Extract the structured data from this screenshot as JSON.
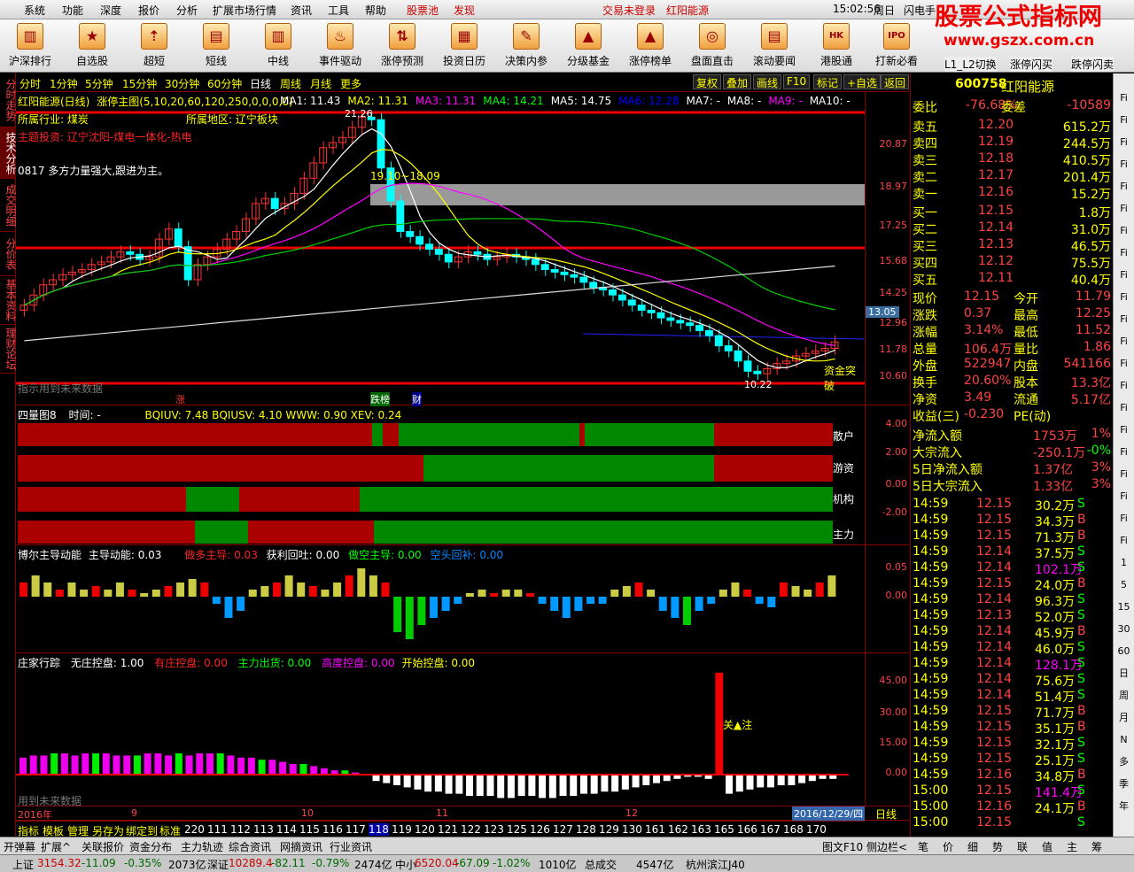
{
  "menu": [
    "系统",
    "功能",
    "深度",
    "报价",
    "分析",
    "扩展市场行情",
    "资讯",
    "工具",
    "帮助",
    "股票池",
    "发现"
  ],
  "menu_status": {
    "login": "交易未登录",
    "stock_name": "红阳能源",
    "time": "15:02:56",
    "weekday": "周日",
    "right": "闪电手"
  },
  "toolbar": [
    "沪深排行",
    "自选股",
    "超短",
    "短线",
    "中线",
    "事件驱动",
    "涨停预测",
    "投资日历",
    "决策内参",
    "分级基金",
    "涨停榜单",
    "盘面直击",
    "滚动要闻",
    "港股通",
    "打新必看"
  ],
  "toolbar_extra": [
    "L1_L2切换",
    "涨停闪买",
    "跌停闪卖"
  ],
  "brand": {
    "title": "股票公式指标网",
    "url": "www.gszx.com.cn"
  },
  "left_tabs": [
    "分时走势",
    "技术分析",
    "成交明细",
    "分价表",
    "基本资料",
    "理财论坛"
  ],
  "periods": [
    "分时",
    "1分钟",
    "5分钟",
    "15分钟",
    "30分钟",
    "60分钟",
    "日线",
    "周线",
    "月线",
    "更多"
  ],
  "period_right": [
    "复权",
    "叠加",
    "画线",
    "F10",
    "标记",
    "+自选",
    "返回"
  ],
  "main": {
    "title": "红阳能源(日线)",
    "indicator": "涨停主图(5,10,20,60,120,250,0,0,0,0)",
    "ma": [
      "MA1: 11.43",
      "MA2: 11.31",
      "MA3: 11.31",
      "MA4: 14.21",
      "MA5: 14.75",
      "MA6: 12.28",
      "MA7: -",
      "MA8: -",
      "MA9: -",
      "MA10: -"
    ],
    "industry": "所属行业: 煤炭",
    "region": "所属地区: 辽宁板块",
    "theme": "主题投资: 辽宁沈阳-煤电一体化-热电",
    "note": "0817  多方力量强大,跟进为主。",
    "hi": "21.26",
    "mid": "19.10~18.09",
    "lo": "10.22",
    "box": "资金突破",
    "future": "指示用到未来数据",
    "tags": [
      "涨",
      "跌榜",
      "财"
    ],
    "yaxis": [
      "20.87",
      "18.97",
      "17.25",
      "15.68",
      "14.25",
      "12.96",
      "11.78",
      "10.60"
    ],
    "cur": "13.05"
  },
  "sub1": {
    "title": "四量图8",
    "time": "时间: -",
    "vals": "BQIUV: 7.48  BQIUSV: 4.10  WWW: 0.90  XEV: 0.24",
    "rows": [
      "散户",
      "游资",
      "机构",
      "主力"
    ],
    "yaxis": [
      "4.00",
      "2.00",
      "0.00",
      "-2.00"
    ]
  },
  "sub2": {
    "title": "博尔主导动能",
    "v1": "主导动能: 0.03",
    "v2": "做多主导: 0.03",
    "v3": "获利回吐: 0.00",
    "v4": "做空主导: 0.00",
    "v5": "空头回补: 0.00",
    "yaxis": [
      "0.05",
      "0.00"
    ]
  },
  "sub3": {
    "title": "庄家行踪",
    "v1": "无庄控盘: 1.00",
    "v2": "有庄控盘: 0.00",
    "v3": "主力出货: 0.00",
    "v4": "高度控盘: 0.00",
    "v5": "开始控盘: 0.00",
    "mark": "关▲注",
    "future": "用到未来数据",
    "yaxis": [
      "45.00",
      "30.00",
      "15.00",
      "0.00"
    ]
  },
  "xaxis": {
    "year": "2016年",
    "months": [
      "9",
      "10",
      "11",
      "12"
    ],
    "date": "2016/12/29/四",
    "period": "日线"
  },
  "bottom_tabs": [
    "指标",
    "模板",
    "管理",
    "另存为",
    "绑定到",
    "标准",
    "220",
    "111",
    "112",
    "113",
    "114",
    "115",
    "116",
    "117",
    "118",
    "119",
    "120",
    "121",
    "122",
    "123",
    "125",
    "126",
    "127",
    "128",
    "129",
    "130",
    "161",
    "162",
    "163",
    "165",
    "166",
    "167",
    "168",
    "170"
  ],
  "quote": {
    "code": "600758",
    "name": "红阳能源",
    "weibi": "-76.68%",
    "weicha": "-10589",
    "asks": [
      [
        "卖五",
        "12.20",
        "615.2万"
      ],
      [
        "卖四",
        "12.19",
        "244.5万"
      ],
      [
        "卖三",
        "12.18",
        "410.5万"
      ],
      [
        "卖二",
        "12.17",
        "201.4万"
      ],
      [
        "卖一",
        "12.16",
        "15.2万"
      ]
    ],
    "bids": [
      [
        "买一",
        "12.15",
        "1.8万"
      ],
      [
        "买二",
        "12.14",
        "31.0万"
      ],
      [
        "买三",
        "12.13",
        "46.5万"
      ],
      [
        "买四",
        "12.12",
        "75.5万"
      ],
      [
        "买五",
        "12.11",
        "40.4万"
      ]
    ],
    "stats": [
      [
        "现价",
        "12.15",
        "今开",
        "11.79"
      ],
      [
        "涨跌",
        "0.37",
        "最高",
        "12.25"
      ],
      [
        "涨幅",
        "3.14%",
        "最低",
        "11.52"
      ],
      [
        "总量",
        "106.4万",
        "量比",
        "1.86"
      ],
      [
        "外盘",
        "522947",
        "内盘",
        "541166"
      ],
      [
        "换手",
        "20.60%",
        "股本",
        "13.3亿"
      ],
      [
        "净资",
        "3.49",
        "流通",
        "5.17亿"
      ],
      [
        "收益(三)",
        "-0.230",
        "PE(动)",
        ""
      ]
    ],
    "flows": [
      [
        "净流入额",
        "1753万",
        "1%"
      ],
      [
        "大宗流入",
        "-250.1万",
        "-0%"
      ],
      [
        "5日净流入额",
        "1.37亿",
        "3%"
      ],
      [
        "5日大宗流入",
        "1.33亿",
        "3%"
      ]
    ],
    "ticks": [
      [
        "14:59",
        "12.15",
        "30.2万",
        "S"
      ],
      [
        "14:59",
        "12.15",
        "34.3万",
        "B"
      ],
      [
        "14:59",
        "12.15",
        "71.3万",
        "B"
      ],
      [
        "14:59",
        "12.14",
        "37.5万",
        "S"
      ],
      [
        "14:59",
        "12.14",
        "102.1万",
        "S"
      ],
      [
        "14:59",
        "12.15",
        "24.0万",
        "B"
      ],
      [
        "14:59",
        "12.14",
        "96.3万",
        "S"
      ],
      [
        "14:59",
        "12.13",
        "52.0万",
        "S"
      ],
      [
        "14:59",
        "12.14",
        "45.9万",
        "B"
      ],
      [
        "14:59",
        "12.14",
        "46.0万",
        "S"
      ],
      [
        "14:59",
        "12.14",
        "128.1万",
        "S"
      ],
      [
        "14:59",
        "12.14",
        "75.6万",
        "S"
      ],
      [
        "14:59",
        "12.14",
        "51.4万",
        "S"
      ],
      [
        "14:59",
        "12.15",
        "71.7万",
        "B"
      ],
      [
        "14:59",
        "12.15",
        "35.1万",
        "B"
      ],
      [
        "14:59",
        "12.15",
        "32.1万",
        "S"
      ],
      [
        "14:59",
        "12.15",
        "25.1万",
        "S"
      ],
      [
        "14:59",
        "12.16",
        "34.8万",
        "B"
      ],
      [
        "15:00",
        "12.15",
        "141.4万",
        "S"
      ],
      [
        "15:00",
        "12.16",
        "24.1万",
        "B"
      ],
      [
        "15:00",
        "12.15",
        "",
        "S"
      ]
    ]
  },
  "right_bar": [
    "Fi",
    "Fi",
    "Fi",
    "Fi",
    "Fi",
    "Fi",
    "Fi",
    "Fi",
    "Fi",
    "Fi",
    "Fi",
    "Fi",
    "Fi",
    "Fi",
    "Fi",
    "Fi",
    "Fi",
    "Fi",
    "Fi",
    "Fi",
    "Fi",
    "1",
    "5",
    "15",
    "30",
    "60",
    "日",
    "周",
    "月",
    "N",
    "多",
    "季",
    "年"
  ],
  "status1": {
    "left": "开弹幕",
    "b1": "扩展^",
    "b2": "关联报价",
    "b3": "资金分布",
    "b4": "主力轨迹",
    "b5": "综合资讯",
    "b6": "网摘资讯",
    "b7": "行业资讯",
    "r1": "图文F10",
    "r2": "侧边栏<",
    "r3": "笔",
    "r4": "价",
    "r5": "细",
    "r6": "势",
    "r7": "联",
    "r8": "值",
    "r9": "主",
    "r10": "筹"
  },
  "status2": {
    "sh": "上证",
    "shv": "3154.32",
    "shc": "-11.09",
    "shp": "-0.35%",
    "sha": "2073亿",
    "sz": "深证",
    "szv": "10289.4",
    "szc": "-82.11",
    "szp": "-0.79%",
    "sza": "2474亿",
    "zx": "中小",
    "zxv": "6520.04",
    "zxc": "-67.09",
    "zxp": "-1.02%",
    "zxa": "1010亿",
    "tot": "总成交",
    "tota": "4547亿",
    "loc": "杭州滨江J40"
  },
  "chart_data": [
    {
      "type": "candlestick",
      "title": "红阳能源(日线)",
      "ylim": [
        10,
        21.5
      ],
      "note": "approx daily closes Aug-Dec 2016",
      "values": [
        13.6,
        14.0,
        14.4,
        14.6,
        14.8,
        14.9,
        15.0,
        15.2,
        15.3,
        15.5,
        15.7,
        15.6,
        15.4,
        15.5,
        16.2,
        16.6,
        15.9,
        14.6,
        15.2,
        15.5,
        15.8,
        16.2,
        16.5,
        17.0,
        17.6,
        17.8,
        17.4,
        17.6,
        18.0,
        18.6,
        19.2,
        19.8,
        20.0,
        20.2,
        20.6,
        21.0,
        20.9,
        19.0,
        17.7,
        16.5,
        16.3,
        16.0,
        15.8,
        15.6,
        15.3,
        15.5,
        15.7,
        15.6,
        15.4,
        15.5,
        15.6,
        15.5,
        15.4,
        15.2,
        15.0,
        14.9,
        14.8,
        14.7,
        14.5,
        14.3,
        14.2,
        14.0,
        13.8,
        13.6,
        13.4,
        13.3,
        13.1,
        13.0,
        12.9,
        12.8,
        12.6,
        12.4,
        12.0,
        11.8,
        11.4,
        11.0,
        10.9,
        11.1,
        11.3,
        11.4,
        11.6,
        11.7,
        11.8,
        11.9,
        12.15
      ]
    },
    {
      "type": "bar",
      "title": "博尔主导动能",
      "values": [
        0.02,
        0.03,
        0.02,
        0.01,
        0.02,
        0.01,
        0.015,
        0.01,
        0.02,
        0.01,
        0.005,
        0.01,
        0.015,
        0.02,
        0.025,
        0.02,
        -0.01,
        -0.03,
        -0.02,
        0.01,
        0.015,
        0.02,
        0.03,
        0.02,
        0.015,
        0.01,
        0.02,
        0.03,
        0.04,
        0.03,
        0.02,
        -0.05,
        -0.06,
        -0.04,
        -0.03,
        -0.02,
        -0.01,
        0.005,
        0.01,
        0.005,
        0.01,
        0.01,
        0.005,
        -0.01,
        -0.02,
        -0.03,
        -0.02,
        -0.01,
        -0.01,
        0.01,
        0.015,
        0.02,
        0.01,
        -0.02,
        -0.03,
        -0.04,
        -0.02,
        -0.01,
        0.01,
        0.02,
        0.01,
        -0.01,
        -0.015,
        0.02,
        0.015,
        0.01,
        0.02,
        0.03
      ]
    },
    {
      "type": "bar",
      "title": "庄家行踪",
      "values": [
        8,
        9,
        9,
        10,
        10,
        9,
        10,
        10,
        10,
        9,
        9,
        9,
        10,
        10,
        9,
        10,
        9,
        10,
        10,
        10,
        9,
        8,
        8,
        7,
        7,
        6,
        5,
        5,
        4,
        3,
        2,
        2,
        1,
        0,
        -3,
        -4,
        -5,
        -6,
        -7,
        -8,
        -8,
        -9,
        -9,
        -10,
        -10,
        -10,
        -11,
        -11,
        -10,
        -10,
        -11,
        -11,
        -10,
        -10,
        -9,
        -9,
        -8,
        -8,
        -7,
        -6,
        -5,
        -4,
        -3,
        -2,
        -1,
        -1,
        -2,
        48,
        -9,
        -8,
        -7,
        -6,
        -6,
        -5,
        -5,
        -4,
        -3,
        -2,
        -2
      ]
    }
  ]
}
